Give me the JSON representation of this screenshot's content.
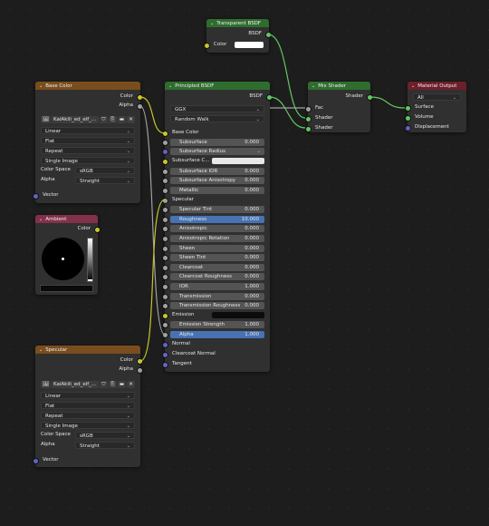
{
  "transparent_bsdf": {
    "title": "Transparent BSDF",
    "output": "BSDF",
    "input_color": "Color",
    "color_value": "#ffffff"
  },
  "mix_shader": {
    "title": "Mix Shader",
    "output": "Shader",
    "inputs": [
      "Fac",
      "Shader",
      "Shader"
    ]
  },
  "material_output": {
    "title": "Material Output",
    "target": "All",
    "inputs": [
      "Surface",
      "Volume",
      "Displacement"
    ]
  },
  "principled": {
    "title": "Principled BSDF",
    "output": "BSDF",
    "distribution": "GGX",
    "subsurface_method": "Random Walk",
    "base_color_label": "Base Color",
    "subsurface": {
      "label": "Subsurface",
      "value": "0.000"
    },
    "subsurface_radius": "Subsurface Radius",
    "subsurface_color": "Subsurface C...",
    "subsurface_ior": {
      "label": "Subsurface IOR",
      "value": "0.000"
    },
    "subsurface_anisotropy": {
      "label": "Subsurface Anisotropy",
      "value": "0.000"
    },
    "metallic": {
      "label": "Metallic",
      "value": "0.000"
    },
    "specular_label": "Specular",
    "specular_tint": {
      "label": "Specular Tint",
      "value": "0.000"
    },
    "roughness": {
      "label": "Roughness",
      "value": "10.000"
    },
    "anisotropic": {
      "label": "Anisotropic",
      "value": "0.000"
    },
    "anisotropic_rotation": {
      "label": "Anisotropic Rotation",
      "value": "0.000"
    },
    "sheen": {
      "label": "Sheen",
      "value": "0.000"
    },
    "sheen_tint": {
      "label": "Sheen Tint",
      "value": "0.000"
    },
    "clearcoat": {
      "label": "Clearcoat",
      "value": "0.000"
    },
    "clearcoat_roughness": {
      "label": "Clearcoat Roughness",
      "value": "0.000"
    },
    "ior": {
      "label": "IOR",
      "value": "1.000"
    },
    "transmission": {
      "label": "Transmission",
      "value": "0.000"
    },
    "transmission_roughness": {
      "label": "Transmission Roughness",
      "value": "0.000"
    },
    "emission_label": "Emission",
    "emission_strength": {
      "label": "Emission Strength",
      "value": "1.000"
    },
    "alpha": {
      "label": "Alpha",
      "value": "1.000"
    },
    "normal": "Normal",
    "clearcoat_normal": "Clearcoat Normal",
    "tangent": "Tangent"
  },
  "base_color_tex": {
    "title": "Base Color",
    "out_color": "Color",
    "out_alpha": "Alpha",
    "image_name": "KaiAkili_ed_elf_...",
    "interpolation": "Linear",
    "projection": "Flat",
    "extension": "Repeat",
    "source": "Single Image",
    "color_space_label": "Color Space",
    "color_space": "sRGB",
    "alpha_label": "Alpha",
    "alpha_mode": "Straight",
    "vector": "Vector"
  },
  "ambient": {
    "title": "Ambient",
    "out_color": "Color"
  },
  "specular_tex": {
    "title": "Specular",
    "out_color": "Color",
    "out_alpha": "Alpha",
    "image_name": "KaiAkili_ed_elf_...",
    "interpolation": "Linear",
    "projection": "Flat",
    "extension": "Repeat",
    "source": "Single Image",
    "color_space_label": "Color Space",
    "color_space": "sRGB",
    "alpha_label": "Alpha",
    "alpha_mode": "Straight",
    "vector": "Vector"
  }
}
